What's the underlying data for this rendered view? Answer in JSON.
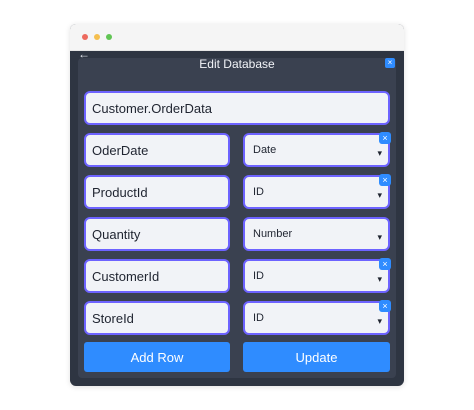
{
  "window": {
    "title": "Edit Database"
  },
  "icons": {
    "back": "arrow-left-icon",
    "close": "close-icon",
    "dropdown": "chevron-down-icon"
  },
  "form": {
    "table_name": "Customer.OrderData",
    "rows": [
      {
        "name": "OderDate",
        "type": "Date"
      },
      {
        "name": "ProductId",
        "type": "ID"
      },
      {
        "name": "Quantity",
        "type": "Number"
      },
      {
        "name": "CustomerId",
        "type": "ID"
      },
      {
        "name": "StoreId",
        "type": "ID"
      }
    ]
  },
  "buttons": {
    "add_row": "Add Row",
    "update": "Update"
  },
  "colors": {
    "accent": "#2f8cff",
    "border": "#6d63ff",
    "panel": "#3a4150"
  },
  "glyphs": {
    "back": "←",
    "close": "×",
    "caret": "▾"
  }
}
